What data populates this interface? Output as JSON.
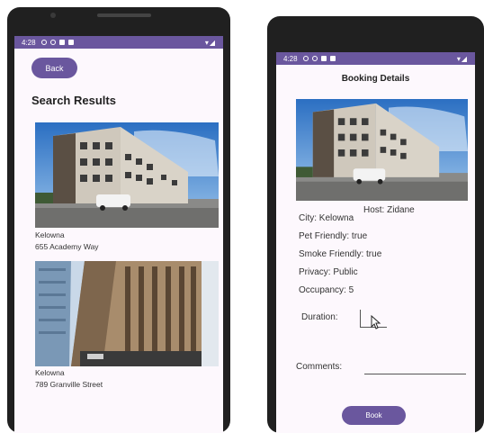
{
  "left": {
    "status": {
      "time": "4:28"
    },
    "back_label": "Back",
    "title": "Search Results",
    "results": [
      {
        "city": "Kelowna",
        "address": "655 Academy Way"
      },
      {
        "city": "Kelowna",
        "address": "789 Granville Street"
      }
    ]
  },
  "right": {
    "status": {
      "time": "4:28"
    },
    "title": "Booking Details",
    "host": "Host: Zidane",
    "city": "City: Kelowna",
    "pet": "Pet Friendly: true",
    "smoke": "Smoke Friendly: true",
    "privacy": "Privacy: Public",
    "occupancy": "Occupancy: 5",
    "duration_label": "Duration:",
    "comments_label": "Comments:",
    "book_label": "Book"
  },
  "colors": {
    "accent": "#6a579e",
    "background": "#fdf8fd"
  }
}
